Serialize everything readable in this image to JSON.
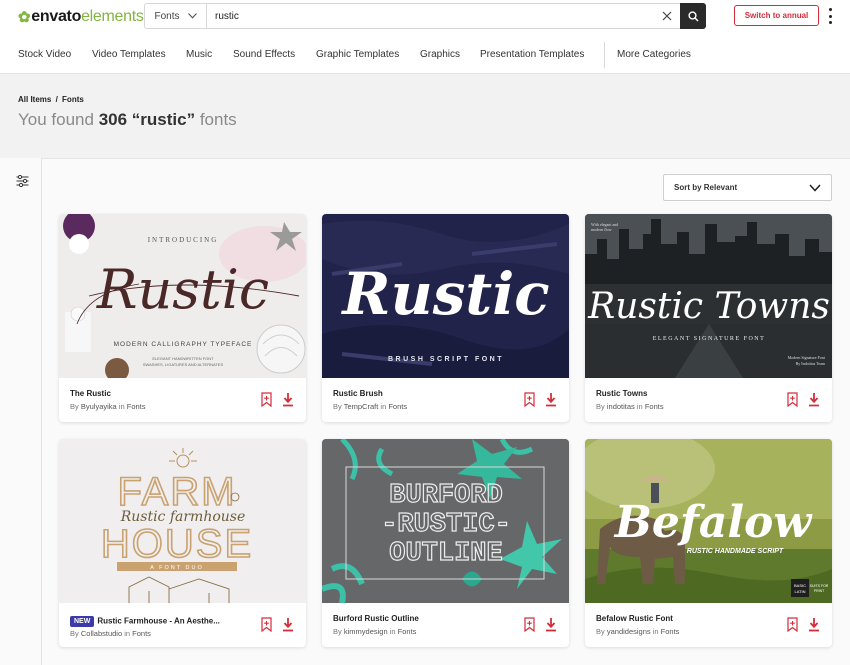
{
  "header": {
    "logo_mark": "✿",
    "logo_bold": "envato",
    "logo_light": "elements",
    "search_category": "Fonts",
    "search_value": "rustic",
    "annual_button": "Switch to annual"
  },
  "nav": {
    "items": [
      "Stock Video",
      "Video Templates",
      "Music",
      "Sound Effects",
      "Graphic Templates",
      "Graphics",
      "Presentation Templates",
      "More Categories"
    ]
  },
  "breadcrumb": {
    "root": "All Items",
    "sep": "/",
    "current": "Fonts"
  },
  "results": {
    "prefix": "You found",
    "count_query": "306 “rustic”",
    "suffix": "fonts"
  },
  "sort": {
    "label": "Sort by Relevant"
  },
  "colors": {
    "accent": "#d52c3a",
    "brand_green": "#82b541",
    "new_badge": "#3b3aa8"
  },
  "cards": [
    {
      "title": "The Rustic",
      "author": "Byulyayika",
      "category": "Fonts",
      "badge": "",
      "thumb": {
        "top_label": "INTRODUCING",
        "main": "Rustic",
        "sub": "MODERN CALLIGRAPHY TYPEFACE",
        "lines": [
          "ELEGANT HANDWRITTEN FONT",
          "SWASHES, LIGATURES AND ALTERNATES"
        ]
      }
    },
    {
      "title": "Rustic Brush",
      "author": "TempCraft",
      "category": "Fonts",
      "badge": "",
      "thumb": {
        "main": "Rustic",
        "sub": "BRUSH SCRIPT FONT"
      }
    },
    {
      "title": "Rustic Towns",
      "author": "indotitas",
      "category": "Fonts",
      "badge": "",
      "thumb": {
        "corner_tl": [
          "With elegant and",
          "modern flow"
        ],
        "main": "Rustic Towns",
        "sub": "ELEGANT SIGNATURE FONT",
        "corner_br": [
          "Modern Signature Font",
          "By Indotitas Team"
        ]
      }
    },
    {
      "title": "Rustic Farmhouse - An Aesthe...",
      "author": "Collabstudio",
      "category": "Fonts",
      "badge": "NEW",
      "thumb": {
        "main_top": "FARM",
        "script": "Rustic farmhouse",
        "main_bottom": "HOUSE",
        "sub": "A FONT DUO"
      }
    },
    {
      "title": "Burford Rustic Outline",
      "author": "kimmydesign",
      "category": "Fonts",
      "badge": "",
      "thumb": {
        "line1": "BURFORD",
        "line2": "-RUSTIC-",
        "line3": "OUTLINE"
      }
    },
    {
      "title": "Befalow Rustic Font",
      "author": "yandidesigns",
      "category": "Fonts",
      "badge": "",
      "thumb": {
        "main": "Befalow",
        "sub": "RUSTIC HANDMADE SCRIPT",
        "corner": [
          "BASIC",
          "LATIN"
        ],
        "corner2": [
          "SUITS FOR",
          "PRINT"
        ]
      }
    }
  ],
  "labels": {
    "by": "By",
    "in": "in"
  }
}
